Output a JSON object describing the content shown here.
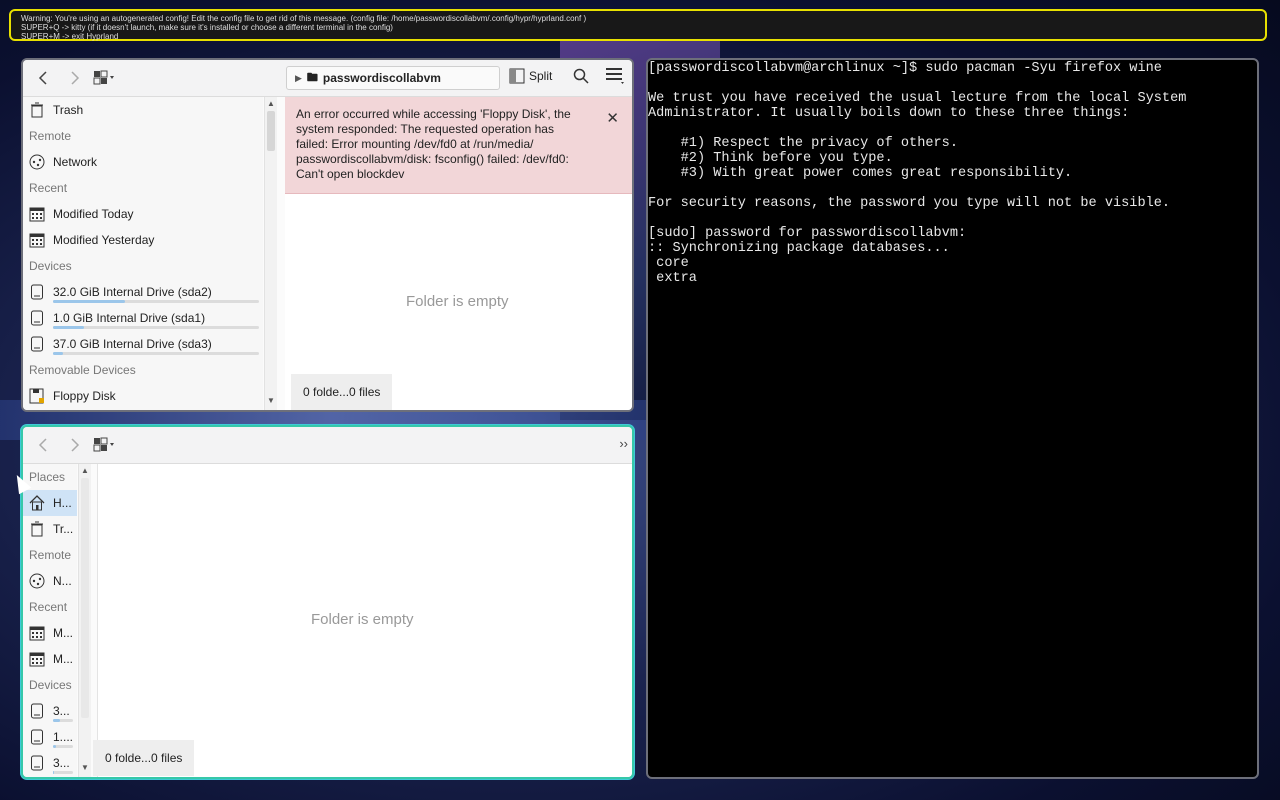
{
  "warning": {
    "line1": "Warning: You're using an autogenerated config! Edit the config file to get rid of this message. (config file: /home/passwordiscollabvm/.config/hypr/hyprland.conf )",
    "line2": "SUPER+Q -> kitty (if it doesn't launch, make sure it's installed or choose a different terminal in the config)",
    "line3": "SUPER+M -> exit Hyprland"
  },
  "dolphin_top": {
    "breadcrumb": "passwordiscollabvm",
    "split_label": "Split",
    "sidebar": [
      {
        "type": "item",
        "label": "Trash",
        "icon": "trash-icon"
      },
      {
        "type": "section",
        "label": "Remote"
      },
      {
        "type": "item",
        "label": "Network",
        "icon": "network-icon"
      },
      {
        "type": "section",
        "label": "Recent"
      },
      {
        "type": "item",
        "label": "Modified Today",
        "icon": "calendar-icon"
      },
      {
        "type": "item",
        "label": "Modified Yesterday",
        "icon": "calendar-icon"
      },
      {
        "type": "section",
        "label": "Devices"
      },
      {
        "type": "item",
        "label": "32.0 GiB Internal Drive (sda2)",
        "icon": "drive-icon",
        "usage": 0.35
      },
      {
        "type": "item",
        "label": "1.0 GiB Internal Drive (sda1)",
        "icon": "drive-icon",
        "usage": 0.15
      },
      {
        "type": "item",
        "label": "37.0 GiB Internal Drive (sda3)",
        "icon": "drive-icon",
        "usage": 0.05
      },
      {
        "type": "section",
        "label": "Removable Devices"
      },
      {
        "type": "item",
        "label": "Floppy Disk",
        "icon": "floppy-icon"
      }
    ],
    "error_message": "An error occurred while accessing 'Floppy Disk', the system responded: The requested operation has failed: Error mounting /dev/fd0 at /run/media/ passwordiscollabvm/disk: fsconfig() failed: /dev/fd0: Can't open blockdev",
    "empty_text": "Folder is empty",
    "status": "0 folde...0 files"
  },
  "dolphin_bottom": {
    "sidebar": [
      {
        "type": "section",
        "label": "Places"
      },
      {
        "type": "item",
        "label": "H...",
        "icon": "home-icon",
        "selected": true
      },
      {
        "type": "item",
        "label": "Tr...",
        "icon": "trash-icon"
      },
      {
        "type": "section",
        "label": "Remote"
      },
      {
        "type": "item",
        "label": "N...",
        "icon": "network-icon"
      },
      {
        "type": "section",
        "label": "Recent"
      },
      {
        "type": "item",
        "label": "M...",
        "icon": "calendar-icon"
      },
      {
        "type": "item",
        "label": "M...",
        "icon": "calendar-icon"
      },
      {
        "type": "section",
        "label": "Devices"
      },
      {
        "type": "item",
        "label": "3...",
        "icon": "drive-icon",
        "usage": 0.35
      },
      {
        "type": "item",
        "label": "1....",
        "icon": "drive-icon",
        "usage": 0.15
      },
      {
        "type": "item",
        "label": "3...",
        "icon": "drive-icon",
        "usage": 0.05
      }
    ],
    "more_label": "››",
    "empty_text": "Folder is empty",
    "status": "0 folde...0 files"
  },
  "terminal": {
    "lines": [
      "[passwordiscollabvm@archlinux ~]$ sudo pacman -Syu firefox wine",
      "",
      "We trust you have received the usual lecture from the local System",
      "Administrator. It usually boils down to these three things:",
      "",
      "    #1) Respect the privacy of others.",
      "    #2) Think before you type.",
      "    #3) With great power comes great responsibility.",
      "",
      "For security reasons, the password you type will not be visible.",
      "",
      "[sudo] password for passwordiscollabvm:",
      ":: Synchronizing package databases...",
      " core",
      " extra"
    ]
  }
}
